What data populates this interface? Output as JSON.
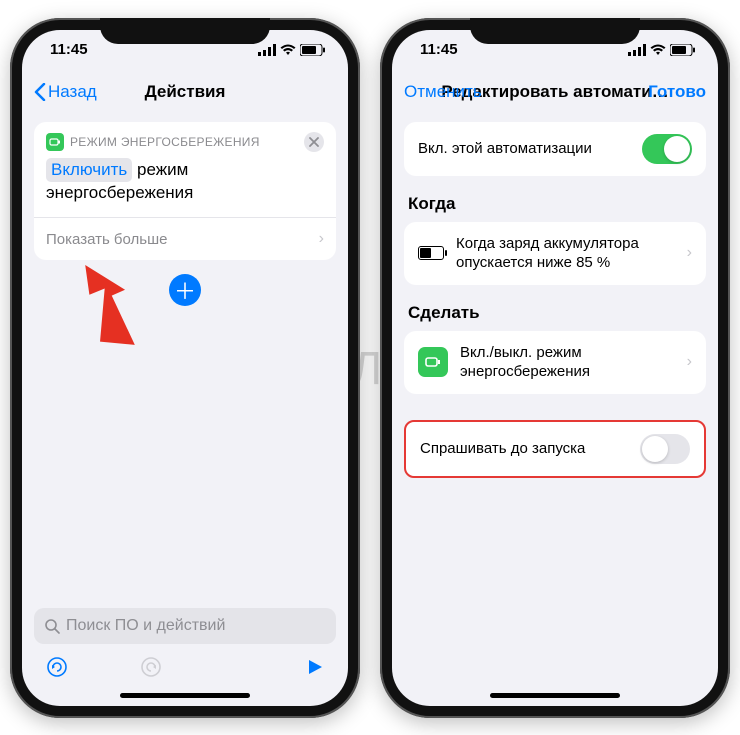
{
  "watermark": "ЯБЛЫК",
  "status": {
    "time": "11:45"
  },
  "left": {
    "nav": {
      "back": "Назад",
      "title": "Действия"
    },
    "action": {
      "header": "РЕЖИМ ЭНЕРГОСБЕРЕЖЕНИЯ",
      "token": "Включить",
      "text1": "режим",
      "text2": "энергосбережения",
      "more": "Показать больше"
    },
    "search": {
      "placeholder": "Поиск ПО и действий"
    }
  },
  "right": {
    "nav": {
      "cancel": "Отменить",
      "title": "Редактировать автомати…",
      "done": "Готово"
    },
    "enable_row": "Вкл. этой автоматизации",
    "when_label": "Когда",
    "when_text": "Когда заряд аккумулятора опускается ниже 85 %",
    "do_label": "Сделать",
    "do_text": "Вкл./выкл. режим энергосбережения",
    "ask_row": "Спрашивать до запуска"
  }
}
